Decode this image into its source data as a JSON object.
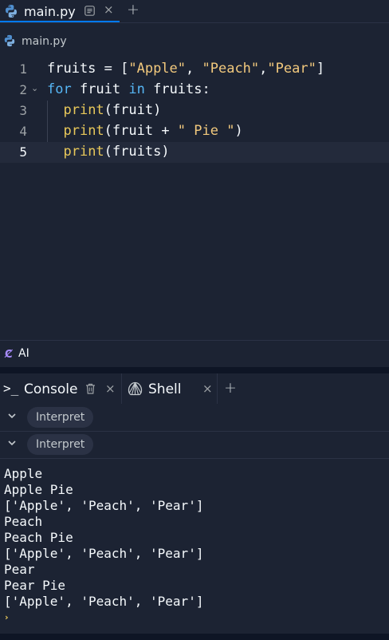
{
  "tabs": {
    "file_tab_label": "main.py",
    "close_glyph": "×",
    "add_glyph": "+"
  },
  "breadcrumb": {
    "label": "main.py"
  },
  "editor": {
    "lines": [
      {
        "number": "1",
        "parts": [
          {
            "t": "fruits = [",
            "c": "plain"
          },
          {
            "t": "\"Apple\"",
            "c": "str"
          },
          {
            "t": ", ",
            "c": "plain"
          },
          {
            "t": "\"Peach\"",
            "c": "str"
          },
          {
            "t": ",",
            "c": "plain"
          },
          {
            "t": "\"Pear\"",
            "c": "str"
          },
          {
            "t": "]",
            "c": "plain"
          }
        ]
      },
      {
        "number": "2",
        "fold": true,
        "parts": [
          {
            "t": "for",
            "c": "kw"
          },
          {
            "t": " fruit ",
            "c": "plain"
          },
          {
            "t": "in",
            "c": "kw"
          },
          {
            "t": " fruits:",
            "c": "plain"
          }
        ]
      },
      {
        "number": "3",
        "parts": [
          {
            "t": "  ",
            "c": "plain"
          },
          {
            "t": "print",
            "c": "fn"
          },
          {
            "t": "(fruit)",
            "c": "plain"
          }
        ]
      },
      {
        "number": "4",
        "parts": [
          {
            "t": "  ",
            "c": "plain"
          },
          {
            "t": "print",
            "c": "fn"
          },
          {
            "t": "(fruit + ",
            "c": "plain"
          },
          {
            "t": "\" Pie \"",
            "c": "str"
          },
          {
            "t": ")",
            "c": "plain"
          }
        ]
      },
      {
        "number": "5",
        "active": true,
        "parts": [
          {
            "t": "  ",
            "c": "plain"
          },
          {
            "t": "print",
            "c": "fn"
          },
          {
            "t": "(fruits)",
            "c": "plain"
          }
        ]
      }
    ]
  },
  "ai_bar": {
    "icon_glyph": "Ȼ",
    "label": "AI"
  },
  "panel_tabs": {
    "console_prompt": ">_",
    "console_label": "Console",
    "shell_label": "Shell",
    "close_glyph": "×",
    "add_glyph": "+"
  },
  "console": {
    "interpret_rows": [
      "Interpret",
      "Interpret"
    ],
    "output": [
      "Apple",
      "Apple Pie",
      "['Apple', 'Peach', 'Pear']",
      "Peach",
      "Peach Pie",
      "['Apple', 'Peach', 'Pear']",
      "Pear",
      "Pear Pie",
      "['Apple', 'Peach', 'Pear']"
    ],
    "prompt_glyph": "›"
  },
  "colors": {
    "background": "#1c2333",
    "accent": "#0079f2",
    "keyword": "#56b6f5",
    "string": "#f2c97d",
    "function": "#e8c85a"
  },
  "icons": [
    "python-icon",
    "preview-icon",
    "close-icon",
    "add-icon",
    "ai-icon",
    "terminal-icon",
    "trash-icon",
    "shell-icon",
    "chevron-down-icon"
  ]
}
